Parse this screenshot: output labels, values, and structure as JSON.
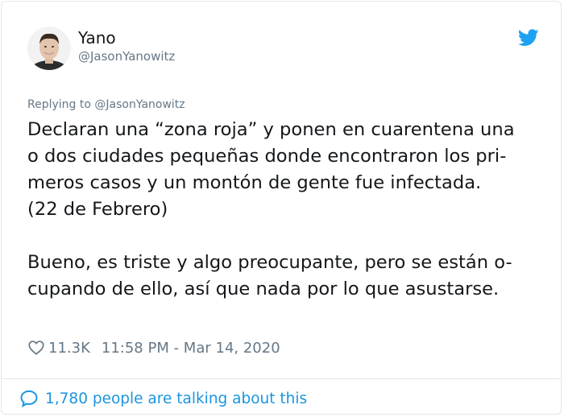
{
  "author": {
    "name": "Yano",
    "handle": "@JasonYanowitz"
  },
  "reply": {
    "text": "Replying to @JasonYanowitz"
  },
  "tweet": {
    "lines": [
      "Declaran una “zona roja” y ponen en cuarentena una",
      "o dos ciudades pequeñas donde encontraron los pri-",
      "meros casos y un montón de gente fue infectada.",
      "(22 de Febrero)",
      "Bueno, es triste y algo preocupante, pero se están o-",
      "cupando de ello, así que nada por lo que asustarse."
    ]
  },
  "meta": {
    "likes": "11.3K",
    "timestamp": "11:58 PM - Mar 14, 2020"
  },
  "footer": {
    "talking": "1,780 people are talking about this"
  },
  "icons": {
    "logo": "twitter-bird-icon",
    "like": "heart-icon",
    "talking": "speech-bubble-icon"
  },
  "colors": {
    "twitter_blue": "#1da1f2",
    "link_blue": "#1b95e0",
    "secondary_text": "#657786",
    "primary_text": "#14171a"
  }
}
